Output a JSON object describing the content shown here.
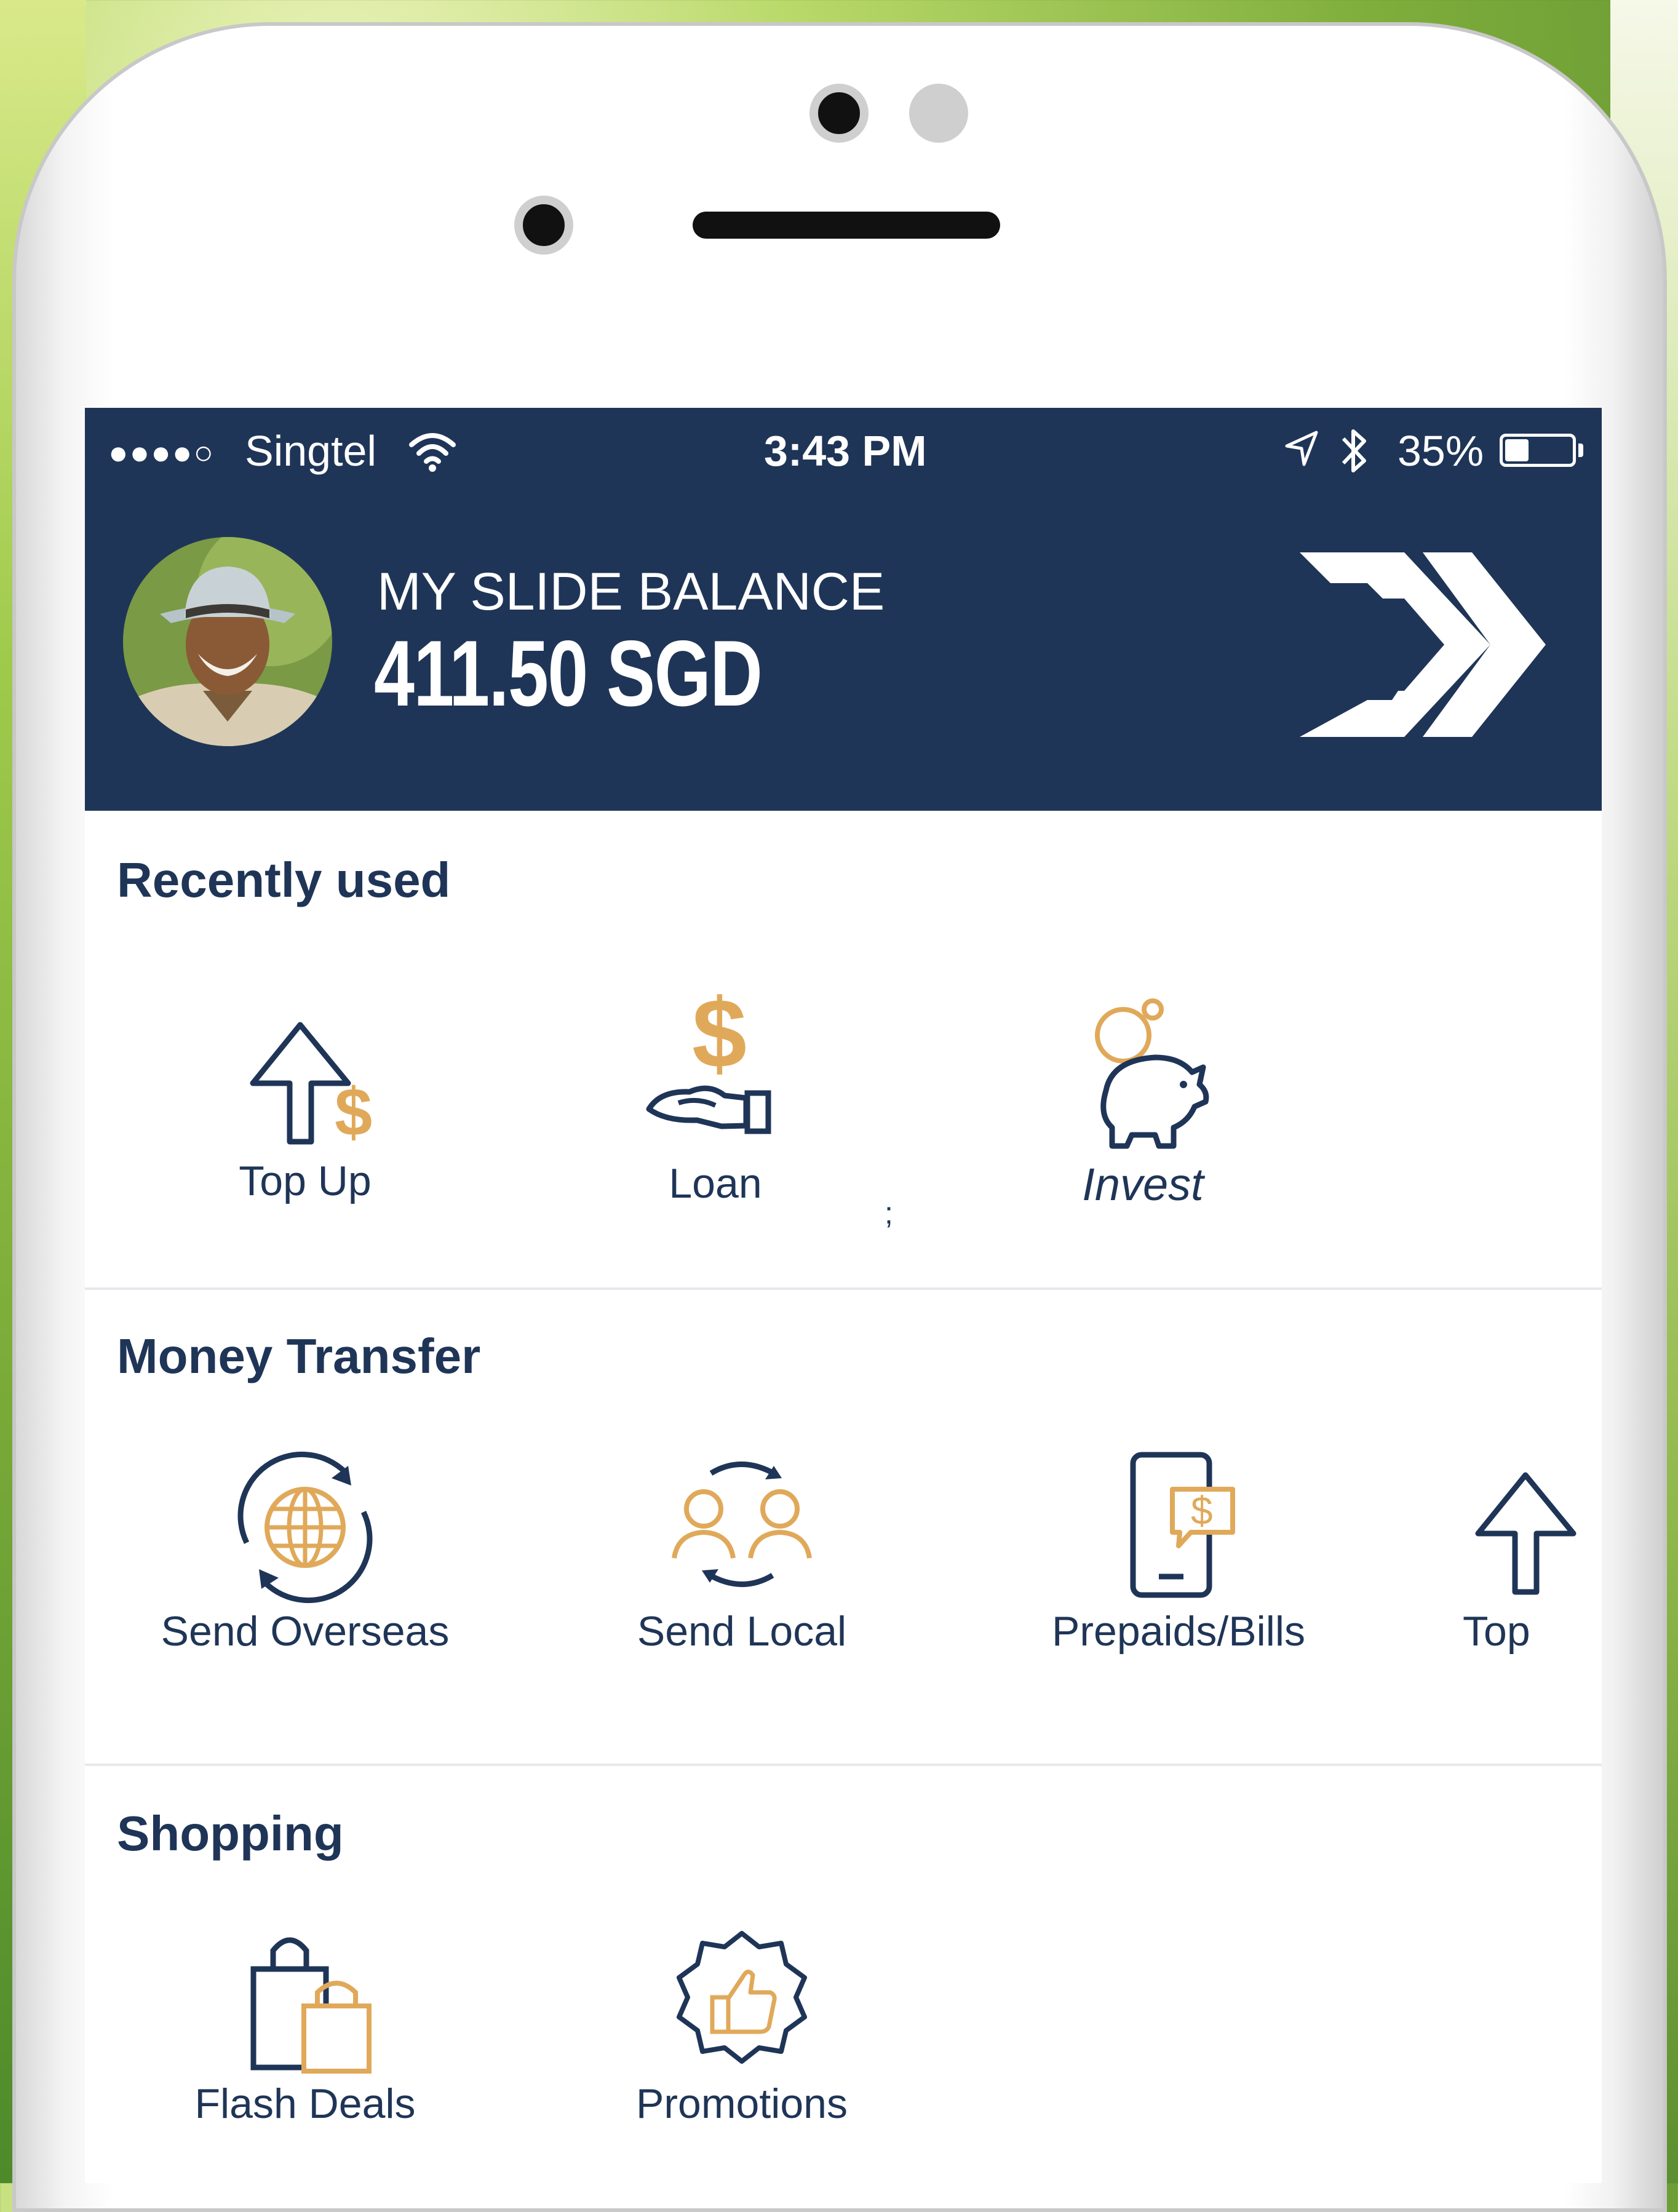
{
  "status_bar": {
    "signal": "●●●●○",
    "carrier": "Singtel",
    "time": "3:43 PM",
    "battery_percent": "35%",
    "battery_level": 0.35
  },
  "balance": {
    "label": "MY SLIDE BALANCE",
    "amount": "411.50 SGD"
  },
  "sections": {
    "recently_used": {
      "title": "Recently used",
      "items": [
        {
          "label": "Top Up",
          "icon": "top-up-icon"
        },
        {
          "label": "Loan",
          "icon": "loan-icon"
        },
        {
          "label": "Invest",
          "icon": "piggy-bank-icon"
        }
      ],
      "stray_mark": ";"
    },
    "money_transfer": {
      "title": "Money Transfer",
      "items": [
        {
          "label": "Send Overseas",
          "icon": "globe-transfer-icon"
        },
        {
          "label": "Send Local",
          "icon": "people-transfer-icon"
        },
        {
          "label": "Prepaids/Bills",
          "icon": "phone-bill-icon"
        },
        {
          "label": "Top",
          "icon": "top-up-icon"
        }
      ]
    },
    "shopping": {
      "title": "Shopping",
      "items": [
        {
          "label": "Flash Deals",
          "icon": "shopping-bags-icon"
        },
        {
          "label": "Promotions",
          "icon": "thumbs-up-badge-icon"
        }
      ]
    }
  },
  "colors": {
    "navy": "#1f3557",
    "gold": "#e0a95a",
    "white": "#ffffff"
  }
}
